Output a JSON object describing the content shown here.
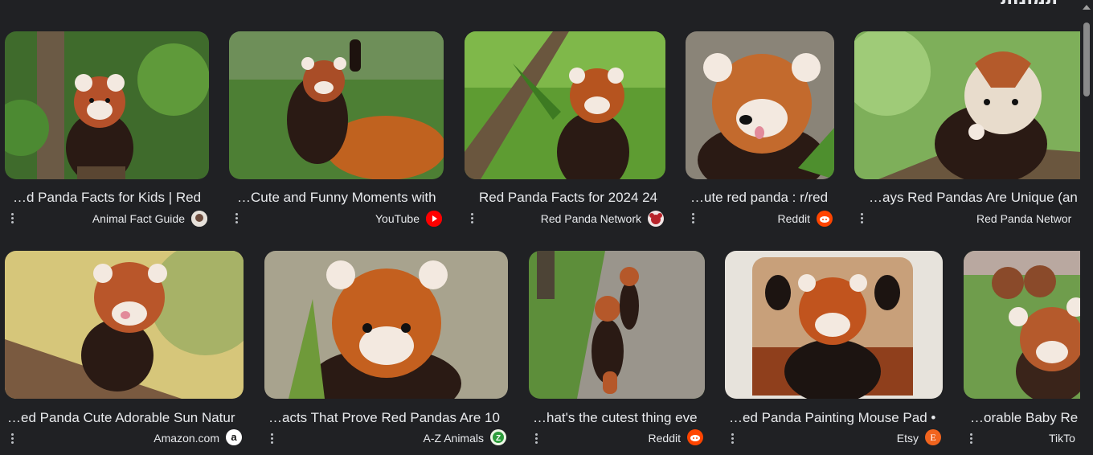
{
  "heading": "תמונות",
  "colors": {
    "background": "#202124",
    "text": "#e8eaed",
    "youtube": "#ff0000",
    "reddit": "#ff4500",
    "etsy": "#f1641e",
    "az_animals": "#2e9d3c"
  },
  "results": [
    {
      "title": "…d Panda Facts for Kids | Red",
      "source": "Animal Fact Guide",
      "favicon": "animal-fact-guide-icon"
    },
    {
      "title": "…Cute and Funny Moments with",
      "source": "YouTube",
      "favicon": "youtube-icon"
    },
    {
      "title": "Red Panda Facts for 2024 24",
      "source": "Red Panda Network",
      "favicon": "red-panda-network-icon"
    },
    {
      "title": "…ute red panda : r/red",
      "source": "Reddit",
      "favicon": "reddit-icon"
    },
    {
      "title": "…ays Red Pandas Are Unique (an",
      "source": "Red Panda Networ",
      "favicon": "red-panda-network-icon"
    },
    {
      "title": "…ed Panda Cute Adorable Sun Natur",
      "source": "Amazon.com",
      "favicon": "amazon-icon"
    },
    {
      "title": "…acts That Prove Red Pandas Are 10",
      "source": "A-Z Animals",
      "favicon": "az-animals-icon"
    },
    {
      "title": "…hat's the cutest thing eve",
      "source": "Reddit",
      "favicon": "reddit-icon"
    },
    {
      "title": "…ed Panda Painting Mouse Pad •",
      "source": "Etsy",
      "favicon": "etsy-icon"
    },
    {
      "title": "…orable Baby Re",
      "source": "TikTo",
      "favicon": "tiktok-icon"
    }
  ]
}
